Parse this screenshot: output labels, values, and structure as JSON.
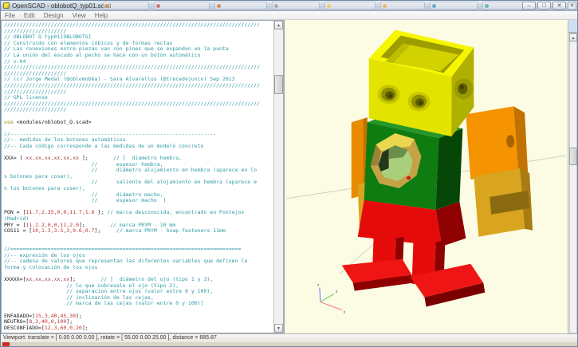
{
  "window": {
    "title": "OpenSCAD - oblobotQ_typ01.scad",
    "controls": {
      "minimize": "–",
      "maximize": "□",
      "close": "✕",
      "bg_close": "✕"
    }
  },
  "menu": {
    "items": [
      "File",
      "Edit",
      "Design",
      "View",
      "Help"
    ]
  },
  "editor": {
    "lines": [
      [
        [
          "c",
          "//////////////////////////////////////////////////////////////////////////////////"
        ]
      ],
      [
        [
          "c",
          "////////////////////"
        ]
      ],
      [
        [
          "c",
          "// OBLOBOT Q typ01[OBLOBOTS]"
        ]
      ],
      [
        [
          "c",
          "// Construido con elementos cúbicos y de formas rectas"
        ]
      ],
      [
        [
          "c",
          "// Las conexiones entre piezas van con pines que se expanden en la punta"
        ]
      ],
      [
        [
          "c",
          "// La unión del escudo al pecho se hace con un botón automático"
        ]
      ],
      [
        [
          "c",
          "// v.04"
        ]
      ],
      [
        [
          "c",
          "//////////////////////////////////////////////////////////////////////////////////"
        ]
      ],
      [
        [
          "c",
          "////////////////////"
        ]
      ],
      [
        [
          "c",
          "// (c) Jorge Medal (@oblomobka) - Sara Alvarellos (@trecedejunio) Sep 2013"
        ]
      ],
      [
        [
          "c",
          "//////////////////////////////////////////////////////////////////////////////////"
        ]
      ],
      [
        [
          "c",
          "////////////////////"
        ]
      ],
      [
        [
          "c",
          "// GPL license"
        ]
      ],
      [
        [
          "c",
          "//////////////////////////////////////////////////////////////////////////////////"
        ]
      ],
      [
        [
          "c",
          "////////////////////"
        ]
      ],
      [],
      [
        [
          "k",
          "use "
        ],
        [
          "p",
          "<modules/oblobot_Q.scad>"
        ]
      ],
      [],
      [
        [
          "c",
          "//------------------------------------------------------------------"
        ]
      ],
      [
        [
          "c",
          "//-- medidas de los botones automáticos"
        ]
      ],
      [
        [
          "c",
          "//-- Cada código corresponde a las medidas de un modelo concreto"
        ]
      ],
      [],
      [
        [
          "p",
          "XXX= [ "
        ],
        [
          "v",
          "xx,xx,xx,xx,xx,xx"
        ],
        [
          "p",
          " ];        "
        ],
        [
          "c",
          "// [  diametro hembra,"
        ]
      ],
      [
        [
          "p",
          "                            "
        ],
        [
          "c",
          "//      espesor hembra,"
        ]
      ],
      [
        [
          "p",
          "                            "
        ],
        [
          "c",
          "//      diámetro alojamiento en hembra (aparece en lo"
        ]
      ],
      [
        [
          "c",
          "s botones para coser),"
        ]
      ],
      [
        [
          "p",
          "                            "
        ],
        [
          "c",
          "//      saliente del alojamiento en hembra (aparece e"
        ]
      ],
      [
        [
          "c",
          "n los botones para coser),"
        ]
      ],
      [
        [
          "p",
          "                            "
        ],
        [
          "c",
          "//      diámetro macho,"
        ]
      ],
      [
        [
          "p",
          "                            "
        ],
        [
          "c",
          "//      espesor macho  ]"
        ]
      ],
      [],
      [
        [
          "p",
          "PON = ["
        ],
        [
          "n",
          "11.7,2.35,0,0,11.7,1.6"
        ],
        [
          "p",
          " ]; "
        ],
        [
          "c",
          "// marca desconocida, encontrado en Pontejos"
        ]
      ],
      [
        [
          "c",
          "(Madrid)"
        ]
      ],
      [
        [
          "p",
          "PRY = ["
        ],
        [
          "n",
          "11,2.2,0,0,11,2.0"
        ],
        [
          "p",
          "];        "
        ],
        [
          "c",
          "// marca PRYM - 10 mm"
        ]
      ],
      [
        [
          "p",
          "COS11 = ["
        ],
        [
          "n",
          "10,1.3,3.5,3,9.6,0.7"
        ],
        [
          "p",
          "];     "
        ],
        [
          "c",
          "// marca PRYM - Snap fasteners 11mm"
        ]
      ],
      [],
      [],
      [
        [
          "c",
          "//=========================================================================="
        ]
      ],
      [
        [
          "c",
          "//-- expresión de los ojos"
        ]
      ],
      [
        [
          "c",
          "//-- cadena de valores que representan las diferentes variables que definen la"
        ]
      ],
      [
        [
          "c",
          "forma y colocación de los ojos"
        ]
      ],
      [],
      [
        [
          "p",
          "XXXXX=["
        ],
        [
          "v",
          "xx,xx,xx,xx,xx"
        ],
        [
          "p",
          "];        "
        ],
        [
          "c",
          "// [  diámetro del ojo (tipo 1 y 3),"
        ]
      ],
      [
        [
          "p",
          "                    "
        ],
        [
          "c",
          "// lo que sobresale el ojo (tipo 2),"
        ]
      ],
      [
        [
          "p",
          "                    "
        ],
        [
          "c",
          "// separacion entre ojos (valor entre 0 y 100),"
        ]
      ],
      [
        [
          "p",
          "                    "
        ],
        [
          "c",
          "// inclinación de las cejas,"
        ]
      ],
      [
        [
          "p",
          "                    "
        ],
        [
          "c",
          "// marca de las cejas (valor entre 0 y 100)]"
        ]
      ],
      [],
      [
        [
          "p",
          "ENFADADO=["
        ],
        [
          "n",
          "15,3,40,45,30"
        ],
        [
          "p",
          "];"
        ]
      ],
      [
        [
          "p",
          "NEUTRO=["
        ],
        [
          "n",
          "8,3,40,0,100"
        ],
        [
          "p",
          "];"
        ]
      ],
      [
        [
          "p",
          "DESCONFIADO=["
        ],
        [
          "n",
          "12,3,60,0,20"
        ],
        [
          "p",
          "];"
        ]
      ]
    ]
  },
  "viewport": {
    "background": "#FCFBE3",
    "axis_labels": {
      "x": "x",
      "y": "y",
      "z": "z"
    },
    "model_colors": {
      "head_yellow": "#E3E300",
      "torso_green": "#0E7C10",
      "arm_orange": "#F59300",
      "hand_gold": "#D9A41E",
      "legs_red": "#E60B0B",
      "shield_tan": "#C4A346",
      "shield_inner_green": "#A9CF7D"
    }
  },
  "statusbar": {
    "text": "Viewport: translate = [ 0.00 0.00 0.00 ], rotate = [ 55.00 0.00 25.00 ], distance = 685.87"
  }
}
